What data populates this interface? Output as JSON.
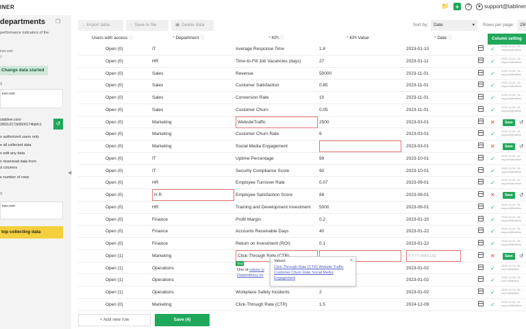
{
  "app": {
    "brand": "INER"
  },
  "topbar": {
    "user_email": "support@tabliner"
  },
  "sidebar": {
    "title": "departments",
    "description": "performance indicators of the",
    "small_1": "iner.com",
    "small_2": "7",
    "change_button": "Change data started",
    "box_1": "iner.com",
    "small_3": "S",
    "link_line_1": "ztabliner.com/",
    "link_line_2": "3002c2173e5600174fabfc1",
    "options": [
      "o authorized users only",
      "e all collected data",
      "o edit any data",
      "n download data from",
      "d columns",
      "e number of rows"
    ],
    "small_4": "S",
    "box_2": "iner.com",
    "stop_button": "top collecting data"
  },
  "toolbar": {
    "import_label": "Import table",
    "save_file_label": "Save to file",
    "delete_label": "Delete data",
    "sort_by_label": "Sort by:",
    "sort_by_value": "Date",
    "rows_per_page_label": "Rows per page:",
    "rows_per_page_value": "250"
  },
  "table": {
    "headers": {
      "access": "Users with access",
      "department": "Department",
      "kpi": "KPI",
      "kpi_value": "KPI Value",
      "date": "Date"
    },
    "column_settings": "Column setting",
    "rows": [
      {
        "access": "Open (0)",
        "dept": "IT",
        "kpi": "Average Response Time",
        "value": "1.8",
        "date": "2023-01-10",
        "status": "ok",
        "meta": "2022-10-24, 15:... support@tabline"
      },
      {
        "access": "Open (0)",
        "dept": "HR",
        "kpi": "Time-to-Fill Job Vacancies (days)",
        "value": "27",
        "date": "2023-01-11",
        "status": "ok",
        "meta": "2022-10-24, 15:... support@tabline"
      },
      {
        "access": "Open (0)",
        "dept": "Sales",
        "kpi": "Revenue",
        "value": "50000",
        "date": "2023-11-01",
        "status": "ok",
        "meta": "2022-10-24, 15:... support@tabline"
      },
      {
        "access": "Open (0)",
        "dept": "Sales",
        "kpi": "Customer Satisfaction",
        "value": "0.85",
        "date": "2023-11-01",
        "status": "ok",
        "meta": "2022-10-24, 15:... support@tabline"
      },
      {
        "access": "Open (0)",
        "dept": "Sales",
        "kpi": "Conversion Rate",
        "value": "10",
        "date": "2023-11-01",
        "status": "ok",
        "meta": "2022-10-24, 15:... support@tabline"
      },
      {
        "access": "Open (0)",
        "dept": "Sales",
        "kpi": "Customer Churn",
        "value": "0.05",
        "date": "2023-11-01",
        "status": "ok",
        "meta": "2022-10-24, 15:... support@tabline"
      },
      {
        "access": "Open (0)",
        "dept": "Marketing",
        "kpi": "WebsiteTraffic",
        "value": "2500",
        "date": "2023-03-01",
        "status": "bad",
        "save": "Save",
        "kpi_err": true
      },
      {
        "access": "Open (0)",
        "dept": "Marketing",
        "kpi": "Customer Churn Rate",
        "value": "6",
        "date": "2023-03-01",
        "status": "ok",
        "meta": "2022-10-24, 15:... support@tabline"
      },
      {
        "access": "Open (0)",
        "dept": "Marketing",
        "kpi": "Social Media Engagement",
        "value": "",
        "date": "2023-03-01",
        "status": "bad",
        "save": "Save",
        "val_err": true
      },
      {
        "access": "Open (0)",
        "dept": "IT",
        "kpi": "Uptime Percentage",
        "value": "99",
        "date": "2023-10-01",
        "status": "ok",
        "meta": "2022-10-24, 15:... support@tabline"
      },
      {
        "access": "Open (0)",
        "dept": "IT",
        "kpi": "Security Compliance Score",
        "value": "90",
        "date": "2023-10-01",
        "status": "ok",
        "meta": "2022-10-24, 15:... support@tabline"
      },
      {
        "access": "Open (0)",
        "dept": "HR",
        "kpi": "Employee Turnover Rate",
        "value": "0.07",
        "date": "2023-09-01",
        "status": "ok",
        "meta": "2022-10-24, 15:... support@tabline"
      },
      {
        "access": "Open (0)",
        "dept": "H R",
        "kpi": "Employee Satisfaction Score",
        "value": "88",
        "date": "2023-09-01",
        "status": "bad",
        "save": "Save",
        "dept_err": true
      },
      {
        "access": "Open (0)",
        "dept": "HR",
        "kpi": "Training and Development Investment",
        "value": "5000",
        "date": "2023-09-01",
        "status": "ok",
        "meta": "2022-10-24, 15:... support@tabline"
      },
      {
        "access": "Open (0)",
        "dept": "Finance",
        "kpi": "Profit Margin",
        "value": "0.2",
        "date": "2023-01-20",
        "status": "ok",
        "meta": "2022-10-24, 15:... support@tabline"
      },
      {
        "access": "Open (0)",
        "dept": "Finance",
        "kpi": "Accounts Receivable Days",
        "value": "40",
        "date": "2023-01-22",
        "status": "ok",
        "meta": "2022-10-24, 15:... support@tabline"
      },
      {
        "access": "Open (0)",
        "dept": "Finance",
        "kpi": "Return on Investment (ROI)",
        "value": "0.1",
        "date": "2023-01-22",
        "status": "ok",
        "meta": "2022-10-24, 15:... support@tabline"
      },
      {
        "access": "Open (1)",
        "dept": "Marketing",
        "kpi": "Click-Through Rate (CTR)",
        "value": "",
        "date": "YYYY-MM-DD",
        "status": "bad",
        "save": "Save",
        "val_err": true,
        "date_err": true,
        "date_ph": true,
        "kpi_active": true
      },
      {
        "access": "Open (1)",
        "dept": "Operations",
        "kpi": "",
        "value": "",
        "date": "2023-01-02",
        "status": "ok",
        "meta": "2022-10-24, 15:... user1@tabline"
      },
      {
        "access": "Open (1)",
        "dept": "Operations",
        "kpi": "",
        "value": "",
        "date": "2023-01-02",
        "status": "ok",
        "meta": "2022-10-24, 15:... user1@tabline"
      },
      {
        "access": "Open (1)",
        "dept": "Operations",
        "kpi": "Workplace Safety Incidents",
        "value": "2",
        "date": "2023-01-02",
        "status": "ok",
        "meta": "2022-10-24, 15:... user1@tabline"
      },
      {
        "access": "Open (0)",
        "dept": "Marketing",
        "kpi": "Click-Through Rate (CTR)",
        "value": "1.5",
        "date": "2024-12-09",
        "status": "ok",
        "meta": "2022-10-24, 15:... support@tabline"
      }
    ]
  },
  "autocomplete": {
    "tag": "Text",
    "help_prefix": "One of",
    "help_link_1": "values (v",
    "help_link_2": "Dependency on",
    "title": "Values:",
    "values": "Click-Through Rate (CTR) Website Traffic Customer Churn Rate Social Media Engagement"
  },
  "footer": {
    "add_row": "Add new row",
    "save": "Save (4)"
  }
}
